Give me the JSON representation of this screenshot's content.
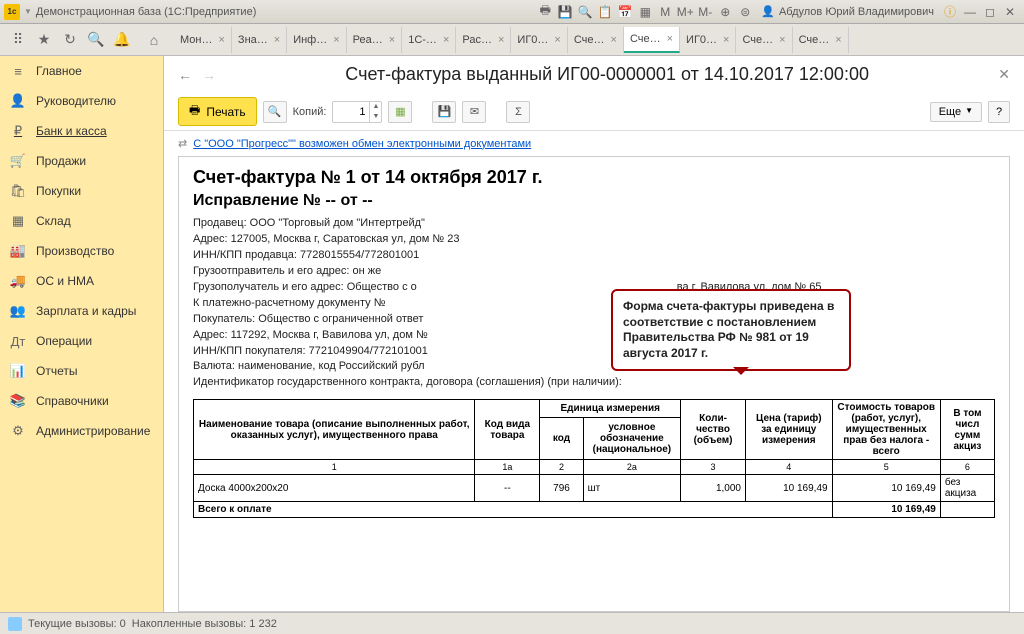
{
  "titlebar": {
    "logo": "1c",
    "title": "Демонстрационная база  (1С:Предприятие)",
    "user": "Абдулов Юрий Владимирович",
    "m": "M",
    "mp": "M+",
    "mm": "M-"
  },
  "tabs": [
    "Мон…",
    "Зна…",
    "Инф…",
    "Реа…",
    "1С-…",
    "Рас…",
    "ИГ0…",
    "Сче…",
    "Сче…",
    "ИГ0…",
    "Сче…",
    "Сче…"
  ],
  "sidebar": [
    {
      "icon": "≡",
      "label": "Главное"
    },
    {
      "icon": "👤",
      "label": "Руководителю"
    },
    {
      "icon": "₽",
      "label": "Банк и касса"
    },
    {
      "icon": "🛒",
      "label": "Продажи"
    },
    {
      "icon": "🛍",
      "label": "Покупки"
    },
    {
      "icon": "▦",
      "label": "Склад"
    },
    {
      "icon": "🏭",
      "label": "Производство"
    },
    {
      "icon": "🚚",
      "label": "ОС и НМА"
    },
    {
      "icon": "👥",
      "label": "Зарплата и кадры"
    },
    {
      "icon": "Дт",
      "label": "Операции"
    },
    {
      "icon": "📊",
      "label": "Отчеты"
    },
    {
      "icon": "📚",
      "label": "Справочники"
    },
    {
      "icon": "⚙",
      "label": "Администрирование"
    }
  ],
  "doc": {
    "title": "Счет-фактура выданный ИГ00-0000001 от 14.10.2017 12:00:00",
    "print": "Печать",
    "copies": "Копий:",
    "copies_val": "1",
    "more": "Еще",
    "link": "С \"ООО \"Прогресс\"\" возможен обмен электронными документами",
    "h2": "Счет-фактура № 1 от 14 октября 2017 г.",
    "h3": "Исправление № -- от --",
    "lines": [
      "Продавец: ООО \"Торговый дом \"Интертрейд\"",
      "Адрес: 127005, Москва г, Саратовская ул, дом № 23",
      "ИНН/КПП продавца: 7728015554/772801001",
      "Грузоотправитель и его адрес: он же",
      "Грузополучатель и его адрес: Общество с о",
      "К платежно-расчетному документу №",
      "Покупатель: Общество с ограниченной ответ",
      "Адрес: 117292, Москва г, Вавилова ул, дом №",
      "ИНН/КПП покупателя: 7721049904/772101001",
      "Валюта: наименование, код Российский рубл",
      "Идентификатор государственного контракта, договора (соглашения) (при наличии):"
    ],
    "line4_suffix": "ва г, Вавилова ул, дом № 65",
    "callout": "Форма счета-фактуры приведена в соответствие с постановлением Правительства РФ № 981 от 19 августа 2017 г."
  },
  "table": {
    "headers": [
      "Наименование товара (описание выполненных работ, оказанных услуг), имущественного права",
      "Код вида товара",
      "Единица измерения",
      "код",
      "условное обозначение (национальное)",
      "Коли-\nчество (объем)",
      "Цена (тариф) за единицу измерения",
      "Стоимость товаров (работ, услуг), имущественных прав без налога - всего",
      "В том числе сумма акциза"
    ],
    "nums": [
      "1",
      "1а",
      "2",
      "2а",
      "3",
      "4",
      "5",
      "6"
    ],
    "row": {
      "name": "Доска 4000х200х20",
      "code": "--",
      "ucode": "796",
      "uname": "шт",
      "qty": "1,000",
      "price": "10 169,49",
      "sum": "10 169,49",
      "excise": "без акциза"
    },
    "total_label": "Всего к оплате",
    "total_sum": "10 169,49"
  },
  "status": {
    "a": "Текущие вызовы: 0",
    "b": "Накопленные вызовы: 1 232"
  }
}
